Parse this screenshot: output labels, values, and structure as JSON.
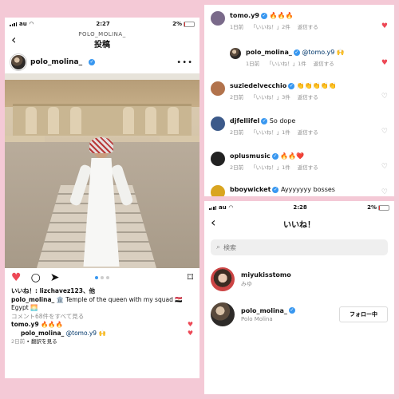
{
  "left": {
    "status": {
      "carrier": "au",
      "time": "2:27",
      "battery": "2%"
    },
    "nav": {
      "back": "‹",
      "subtitle": "POLO_MOLINA_",
      "title": "投稿"
    },
    "post_user": "polo_molina_",
    "more": "•••",
    "carousel": {
      "count": 3,
      "active": 0
    },
    "likes_text": "いいね！: lizchavez123、他",
    "caption": {
      "user": "polo_molina_",
      "text": "🏛️ Temple of the queen with my squad 🇪🇬 Egypt 🌅"
    },
    "view_comments": "コメント68件をすべて見る",
    "comments": [
      {
        "user": "tomo.y9",
        "text": "🔥🔥🔥"
      },
      {
        "user": "polo_molina_",
        "mention": "@tomo.y9",
        "text": "🙌"
      }
    ],
    "footer": {
      "time": "2日前",
      "translate": "翻訳を見る"
    }
  },
  "topright": {
    "comments": [
      {
        "user": "tomo.y9",
        "text": "🔥🔥🔥",
        "time": "1日前",
        "likes": "「いいね！」2件",
        "reply": "返信する",
        "liked": true
      },
      {
        "user": "polo_molina_",
        "mention": "@tomo.y9",
        "text": "🙌",
        "time": "1日前",
        "likes": "「いいね！」1件",
        "reply": "返信する",
        "liked": true
      },
      {
        "user": "suziedelvecchio",
        "text": "👏👏👏👏👏",
        "time": "2日前",
        "likes": "「いいね！」3件",
        "reply": "返信する",
        "liked": false
      },
      {
        "user": "djfellifel",
        "text": "So dope",
        "time": "2日前",
        "likes": "「いいね！」1件",
        "reply": "返信する",
        "liked": false
      },
      {
        "user": "oplusmusic",
        "text": "🔥🔥❤️",
        "time": "2日前",
        "likes": "「いいね！」1件",
        "reply": "返信する",
        "liked": false
      },
      {
        "user": "bboywicket",
        "text": "Ayyyyyyy bosses",
        "liked": false
      }
    ]
  },
  "bottomright": {
    "status": {
      "carrier": "au",
      "time": "2:28",
      "battery": "2%"
    },
    "nav": {
      "back": "‹",
      "title": "いいね！"
    },
    "search": {
      "placeholder": "検索",
      "value": ""
    },
    "likers": [
      {
        "user": "miyukisstomo",
        "name": "みゆ"
      },
      {
        "user": "polo_molina_",
        "name": "Polo Molina",
        "button": "フォロー中"
      }
    ]
  }
}
